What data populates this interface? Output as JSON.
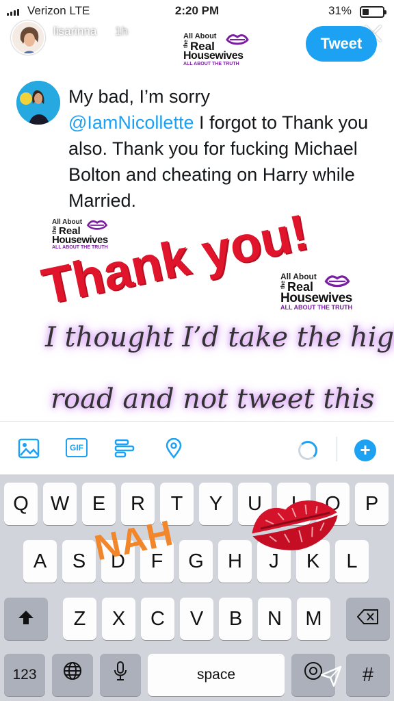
{
  "status_bar": {
    "carrier": "Verizon  LTE",
    "time": "2:20 PM",
    "battery_text": "31%",
    "battery_level": 0.31
  },
  "story": {
    "username": "lisarinna",
    "age": "1h"
  },
  "compose": {
    "tweet_button": "Tweet",
    "tweet_text_line1": "My bad, I’m sorry",
    "tweet_mention": "@IamNicollette",
    "tweet_text_rest": " I forgot to Thank you also. Thank you for fucking Michael Bolton and cheating on Harry while Married."
  },
  "watermark": {
    "line1": "All About",
    "the": "the",
    "line2": "Real",
    "line3": "Housewives",
    "line4": "ALL ABOUT THE TRUTH"
  },
  "stickers": {
    "thank_you": "Thank you!",
    "caption_line1": "I thought I’d take the high",
    "caption_line2": "road and not tweet this",
    "nah": "NAH"
  },
  "toolbar": {
    "gif_label": "GIF"
  },
  "keyboard": {
    "row1": [
      "Q",
      "W",
      "E",
      "R",
      "T",
      "Y",
      "U",
      "I",
      "O",
      "P"
    ],
    "row2": [
      "A",
      "S",
      "D",
      "F",
      "G",
      "H",
      "J",
      "K",
      "L"
    ],
    "row3": [
      "Z",
      "X",
      "C",
      "V",
      "B",
      "N",
      "M"
    ],
    "numbers_key": "123",
    "space_key": "space",
    "hash_key": "#"
  },
  "colors": {
    "twitter_blue": "#1da1f2",
    "thank_you_red": "#e0142b",
    "nah_orange": "#f2862b",
    "lips_red": "#d4122a"
  }
}
